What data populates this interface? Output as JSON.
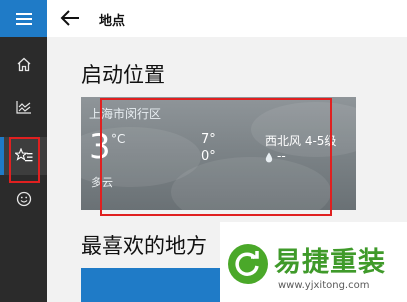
{
  "page": {
    "title": "地点"
  },
  "sidebar": {
    "items": [
      {
        "icon": "home-icon"
      },
      {
        "icon": "chart-icon"
      },
      {
        "icon": "favorites-icon"
      },
      {
        "icon": "smiley-icon"
      }
    ],
    "active_index": 2
  },
  "sections": {
    "startup_title": "启动位置",
    "favorites_title": "最喜欢的地方"
  },
  "weather_card": {
    "location": "上海市闵行区",
    "temperature": "3",
    "unit": "°C",
    "condition": "多云",
    "high": "7°",
    "low": "0°",
    "wind": "西北风 4-5级",
    "precipitation": "--"
  },
  "watermark": {
    "brand": "易捷重装",
    "url": "www.yjxitong.com"
  },
  "colors": {
    "accent": "#1f7bc7",
    "sidebar": "#2b2b2b",
    "highlight": "#e02020"
  }
}
